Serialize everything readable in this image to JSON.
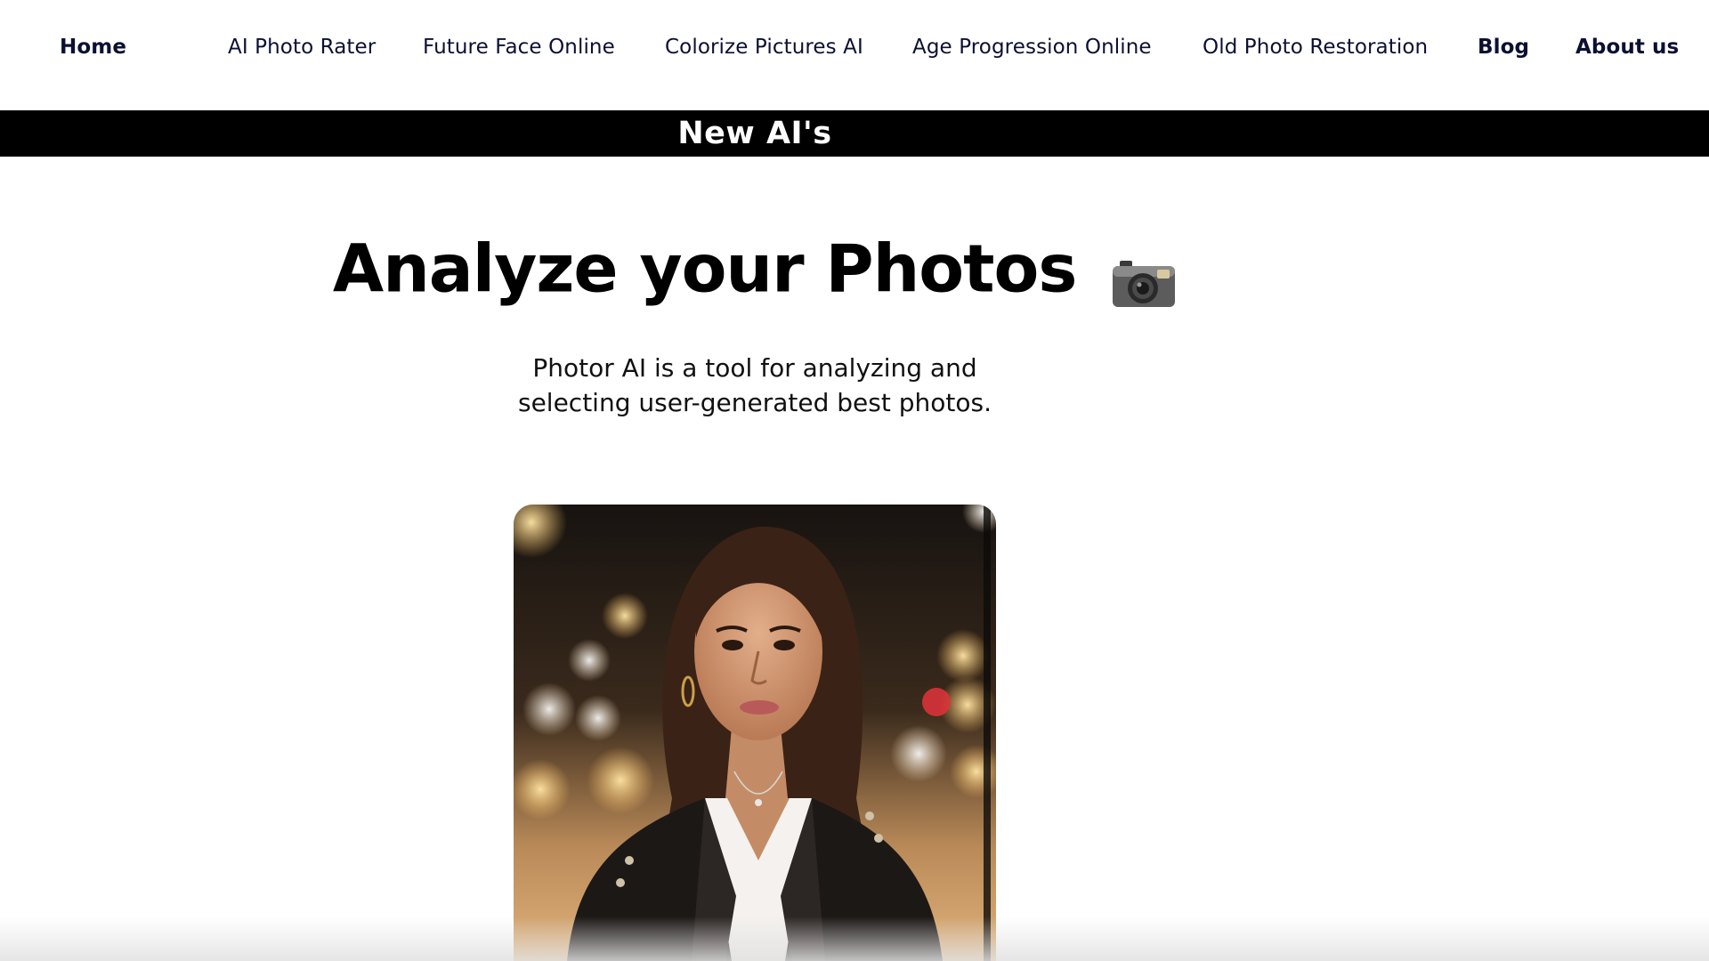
{
  "nav": {
    "items": [
      {
        "label": "Home"
      },
      {
        "label": "AI Photo Rater"
      },
      {
        "label": "Future Face Online"
      },
      {
        "label": "Colorize Pictures AI"
      },
      {
        "label": "Age Progression Online"
      },
      {
        "label": "Old Photo Restoration"
      },
      {
        "label": "Blog"
      },
      {
        "label": "About us"
      }
    ]
  },
  "banner": {
    "text": "New AI's"
  },
  "hero": {
    "title": "Analyze your Photos",
    "title_icon": "camera-icon",
    "subtitle_line1": "Photor AI is a tool for analyzing and",
    "subtitle_line2": "selecting user-generated best photos."
  },
  "colors": {
    "nav_text": "#0b1033",
    "banner_bg": "#000000",
    "banner_text": "#ffffff",
    "title": "#000000"
  }
}
